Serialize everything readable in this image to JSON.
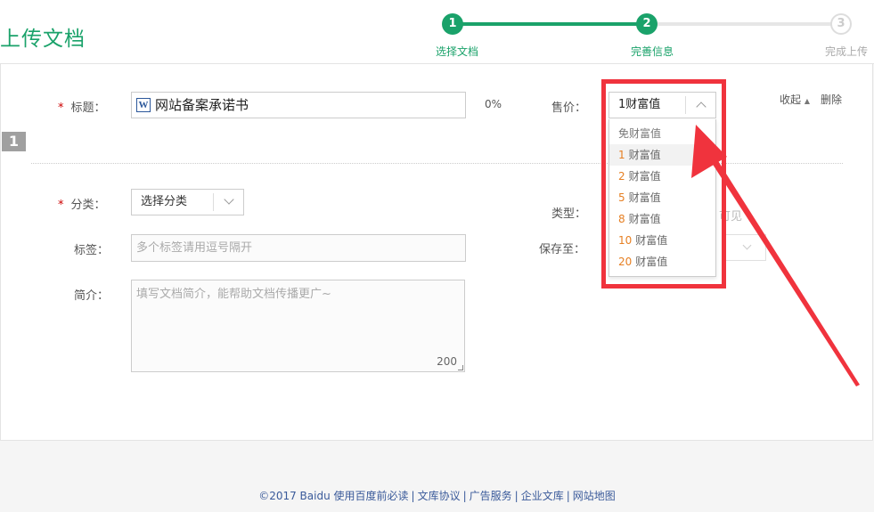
{
  "header": {
    "title": "上传文档",
    "steps": [
      {
        "num": "1",
        "label": "选择文档"
      },
      {
        "num": "2",
        "label": "完善信息"
      },
      {
        "num": "3",
        "label": "完成上传"
      }
    ]
  },
  "form": {
    "doc_number": "1",
    "title_label": "标题：",
    "title_value": "网站备案承诺书",
    "file_icon_letter": "W",
    "progress": "0%",
    "price_label": "售价：",
    "price_value": "1财富值",
    "price_options": [
      {
        "num": "",
        "unit": "免财富值"
      },
      {
        "num": "1",
        "unit": "财富值"
      },
      {
        "num": "2",
        "unit": "财富值"
      },
      {
        "num": "5",
        "unit": "财富值"
      },
      {
        "num": "8",
        "unit": "财富值"
      },
      {
        "num": "10",
        "unit": "财富值"
      },
      {
        "num": "20",
        "unit": "财富值"
      }
    ],
    "collapse_label": "收起",
    "delete_label": "删除",
    "category_label": "分类：",
    "category_value": "选择分类",
    "type_label": "类型：",
    "type_partial_text": "可见",
    "tags_label": "标签：",
    "tags_placeholder": "多个标签请用逗号隔开",
    "save_to_label": "保存至：",
    "intro_label": "简介：",
    "intro_placeholder": "填写文档简介，能帮助文档传播更广~",
    "intro_counter": "200",
    "required_mark": "*"
  },
  "footer": {
    "copyright": "©2017 Baidu",
    "links": [
      "使用百度前必读",
      "文库协议",
      "广告服务",
      "企业文库",
      "网站地图"
    ]
  },
  "colors": {
    "brand_green": "#1aa26a",
    "annotation_red": "#f0333d",
    "option_orange": "#e67f22"
  }
}
